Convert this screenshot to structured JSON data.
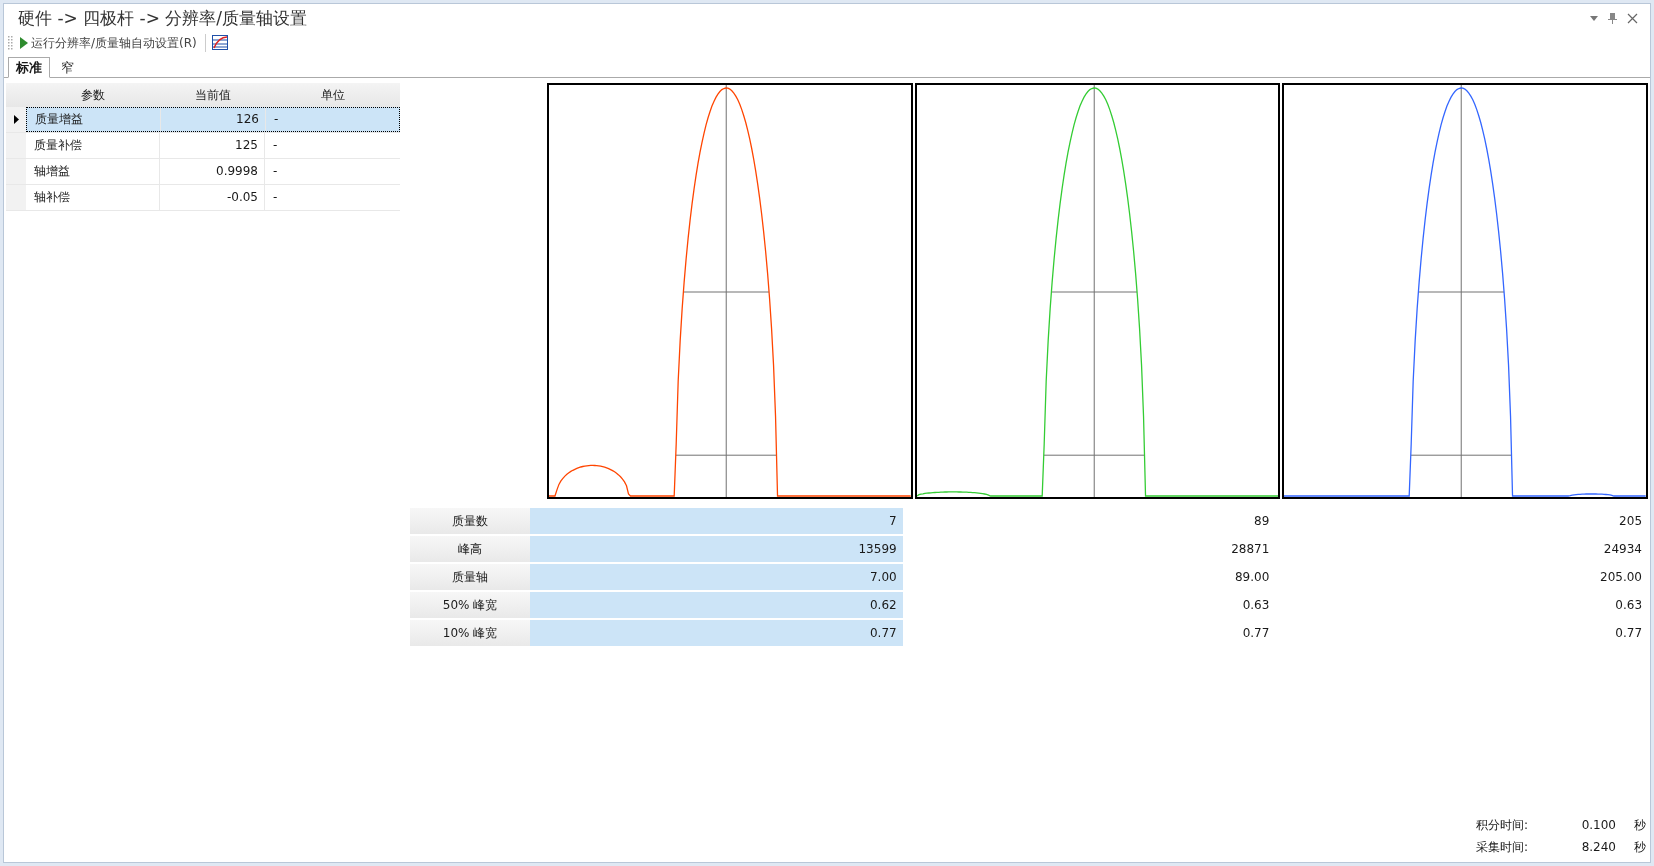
{
  "title": "硬件 -> 四极杆 -> 分辨率/质量轴设置",
  "toolbar": {
    "run_label": "运行分辨率/质量轴自动设置(R)"
  },
  "tabs": [
    {
      "label": "标准",
      "selected": true
    },
    {
      "label": "窄",
      "selected": false
    }
  ],
  "params": {
    "columns": [
      "参数",
      "当前值",
      "单位"
    ],
    "rows": [
      {
        "name": "质量增益",
        "value": "126",
        "unit": "-",
        "selected": true
      },
      {
        "name": "质量补偿",
        "value": "125",
        "unit": "-",
        "selected": false
      },
      {
        "name": "轴增益",
        "value": "0.9998",
        "unit": "-",
        "selected": false
      },
      {
        "name": "轴补偿",
        "value": "-0.05",
        "unit": "-",
        "selected": false
      }
    ]
  },
  "plots": [
    {
      "color": "#ff4500"
    },
    {
      "color": "#33cc33"
    },
    {
      "color": "#3366ff"
    }
  ],
  "results": {
    "columns": [
      {
        "selected": true
      },
      {
        "selected": false
      },
      {
        "selected": false
      }
    ],
    "rows": [
      {
        "label": "质量数",
        "values": [
          "7",
          "89",
          "205"
        ]
      },
      {
        "label": "峰高",
        "values": [
          "13599",
          "28871",
          "24934"
        ]
      },
      {
        "label": "质量轴",
        "values": [
          "7.00",
          "89.00",
          "205.00"
        ]
      },
      {
        "label": "50% 峰宽",
        "values": [
          "0.62",
          "0.63",
          "0.63"
        ]
      },
      {
        "label": "10% 峰宽",
        "values": [
          "0.77",
          "0.77",
          "0.77"
        ]
      }
    ]
  },
  "timing": [
    {
      "label": "积分时间:",
      "value": "0.100",
      "unit": "秒"
    },
    {
      "label": "采集时间:",
      "value": "8.240",
      "unit": "秒"
    }
  ]
}
